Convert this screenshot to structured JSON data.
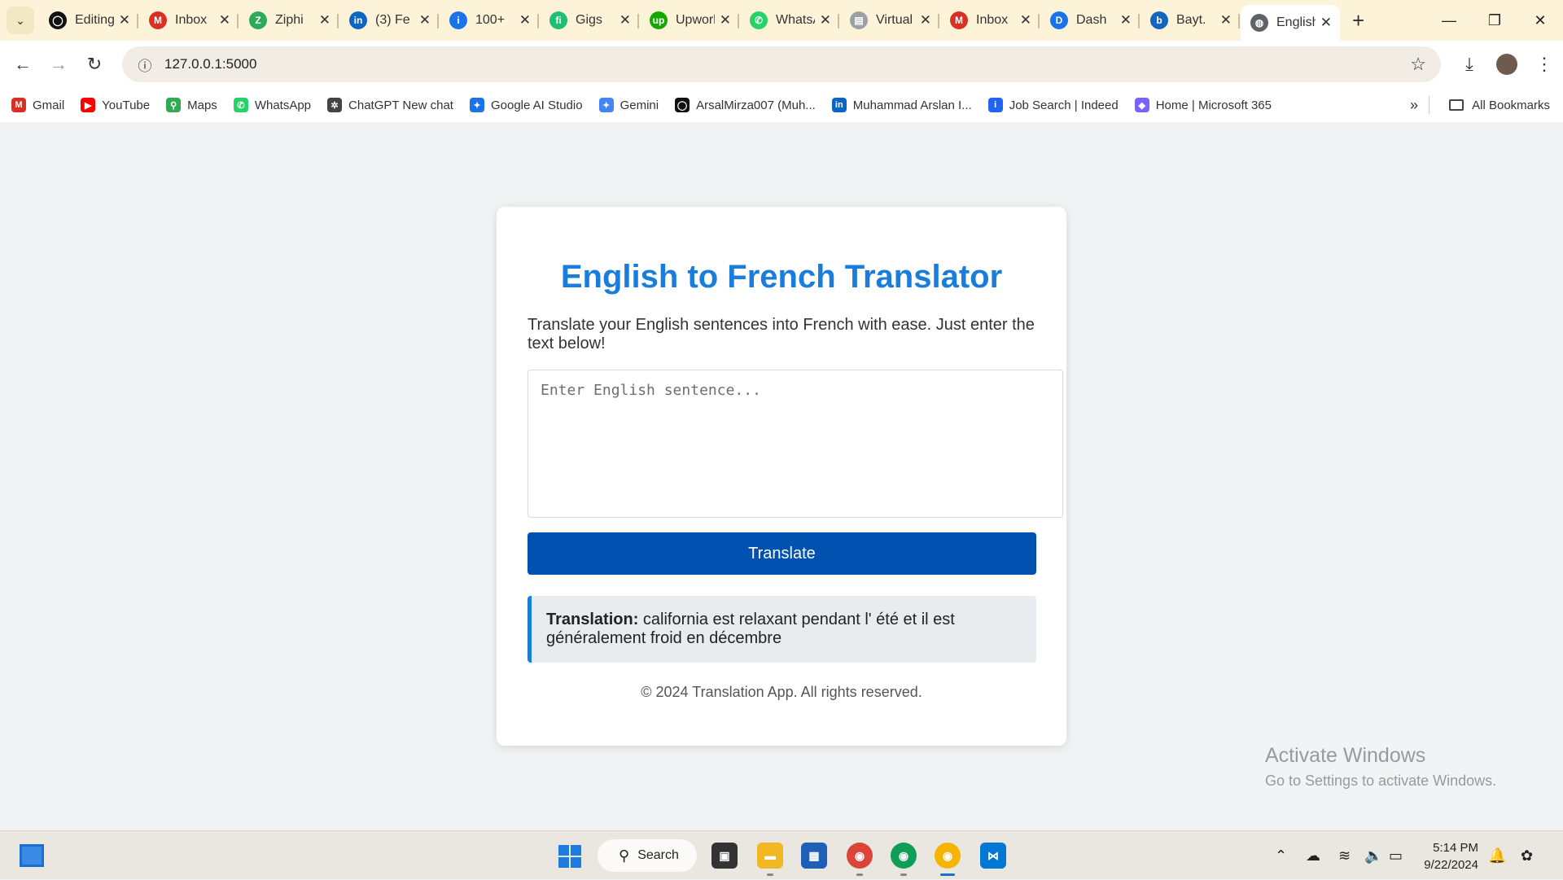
{
  "browser": {
    "tabs": [
      {
        "label": "Editing",
        "icon": "github-icon",
        "color": "#111111",
        "glyph": "◯"
      },
      {
        "label": "Inbox",
        "icon": "gmail-icon",
        "color": "#d93025",
        "glyph": "M"
      },
      {
        "label": "Ziphi",
        "icon": "ziphi-icon",
        "color": "#2eaa5c",
        "glyph": "Z"
      },
      {
        "label": "(3) Fe",
        "icon": "linkedin-icon",
        "color": "#0a66c2",
        "glyph": "in"
      },
      {
        "label": "100+",
        "icon": "info-icon",
        "color": "#1a73e8",
        "glyph": "i"
      },
      {
        "label": "Gigs",
        "icon": "fiverr-icon",
        "color": "#1dbf73",
        "glyph": "fi"
      },
      {
        "label": "Upwork",
        "icon": "upwork-icon",
        "color": "#14a800",
        "glyph": "up"
      },
      {
        "label": "WhatsApp",
        "icon": "whatsapp-icon",
        "color": "#25d366",
        "glyph": "✆"
      },
      {
        "label": "Virtual",
        "icon": "document-icon",
        "color": "#9aa0a6",
        "glyph": "▤"
      },
      {
        "label": "Inbox",
        "icon": "gmail-icon",
        "color": "#d93025",
        "glyph": "M"
      },
      {
        "label": "Dash",
        "icon": "dashboard-icon",
        "color": "#1a73e8",
        "glyph": "D"
      },
      {
        "label": "Bayt.",
        "icon": "bayt-icon",
        "color": "#1565c0",
        "glyph": "b"
      },
      {
        "label": "English",
        "icon": "globe-icon",
        "color": "#5f6368",
        "glyph": "◍",
        "active": true
      }
    ],
    "url": "127.0.0.1:5000",
    "bookmarks": [
      {
        "label": "Gmail",
        "icon": "gmail-icon",
        "color": "#d93025",
        "glyph": "M"
      },
      {
        "label": "YouTube",
        "icon": "youtube-icon",
        "color": "#ff0000",
        "glyph": "▶"
      },
      {
        "label": "Maps",
        "icon": "maps-icon",
        "color": "#34a853",
        "glyph": "⚲"
      },
      {
        "label": "WhatsApp",
        "icon": "whatsapp-icon",
        "color": "#25d366",
        "glyph": "✆"
      },
      {
        "label": "ChatGPT New chat",
        "icon": "chatgpt-icon",
        "color": "#444444",
        "glyph": "✲"
      },
      {
        "label": "Google AI Studio",
        "icon": "ai-studio-icon",
        "color": "#1a73e8",
        "glyph": "✦"
      },
      {
        "label": "Gemini",
        "icon": "gemini-icon",
        "color": "#4285f4",
        "glyph": "✦"
      },
      {
        "label": "ArsalMirza007 (Muh...",
        "icon": "github-icon",
        "color": "#111111",
        "glyph": "◯"
      },
      {
        "label": "Muhammad Arslan I...",
        "icon": "linkedin-icon",
        "color": "#0a66c2",
        "glyph": "in"
      },
      {
        "label": "Job Search | Indeed",
        "icon": "indeed-icon",
        "color": "#2164f3",
        "glyph": "i"
      },
      {
        "label": "Home | Microsoft 365",
        "icon": "microsoft365-icon",
        "color": "#7b61ff",
        "glyph": "◆"
      }
    ],
    "all_bookmarks_label": "All Bookmarks"
  },
  "app": {
    "title": "English to French Translator",
    "subtitle": "Translate your English sentences into French with ease. Just enter the text below!",
    "input_placeholder": "Enter English sentence...",
    "translate_label": "Translate",
    "result_label": "Translation:",
    "result_text": "california est relaxant pendant l' été et il est généralement froid en décembre",
    "footer": "© 2024 Translation App. All rights reserved.",
    "colors": {
      "title": "#1a7cdb",
      "button": "#0151b0",
      "accent": "#1a7cdb"
    }
  },
  "watermark": {
    "line1": "Activate Windows",
    "line2": "Go to Settings to activate Windows."
  },
  "taskbar": {
    "search_label": "Search",
    "time": "5:14 PM",
    "date": "9/22/2024"
  }
}
